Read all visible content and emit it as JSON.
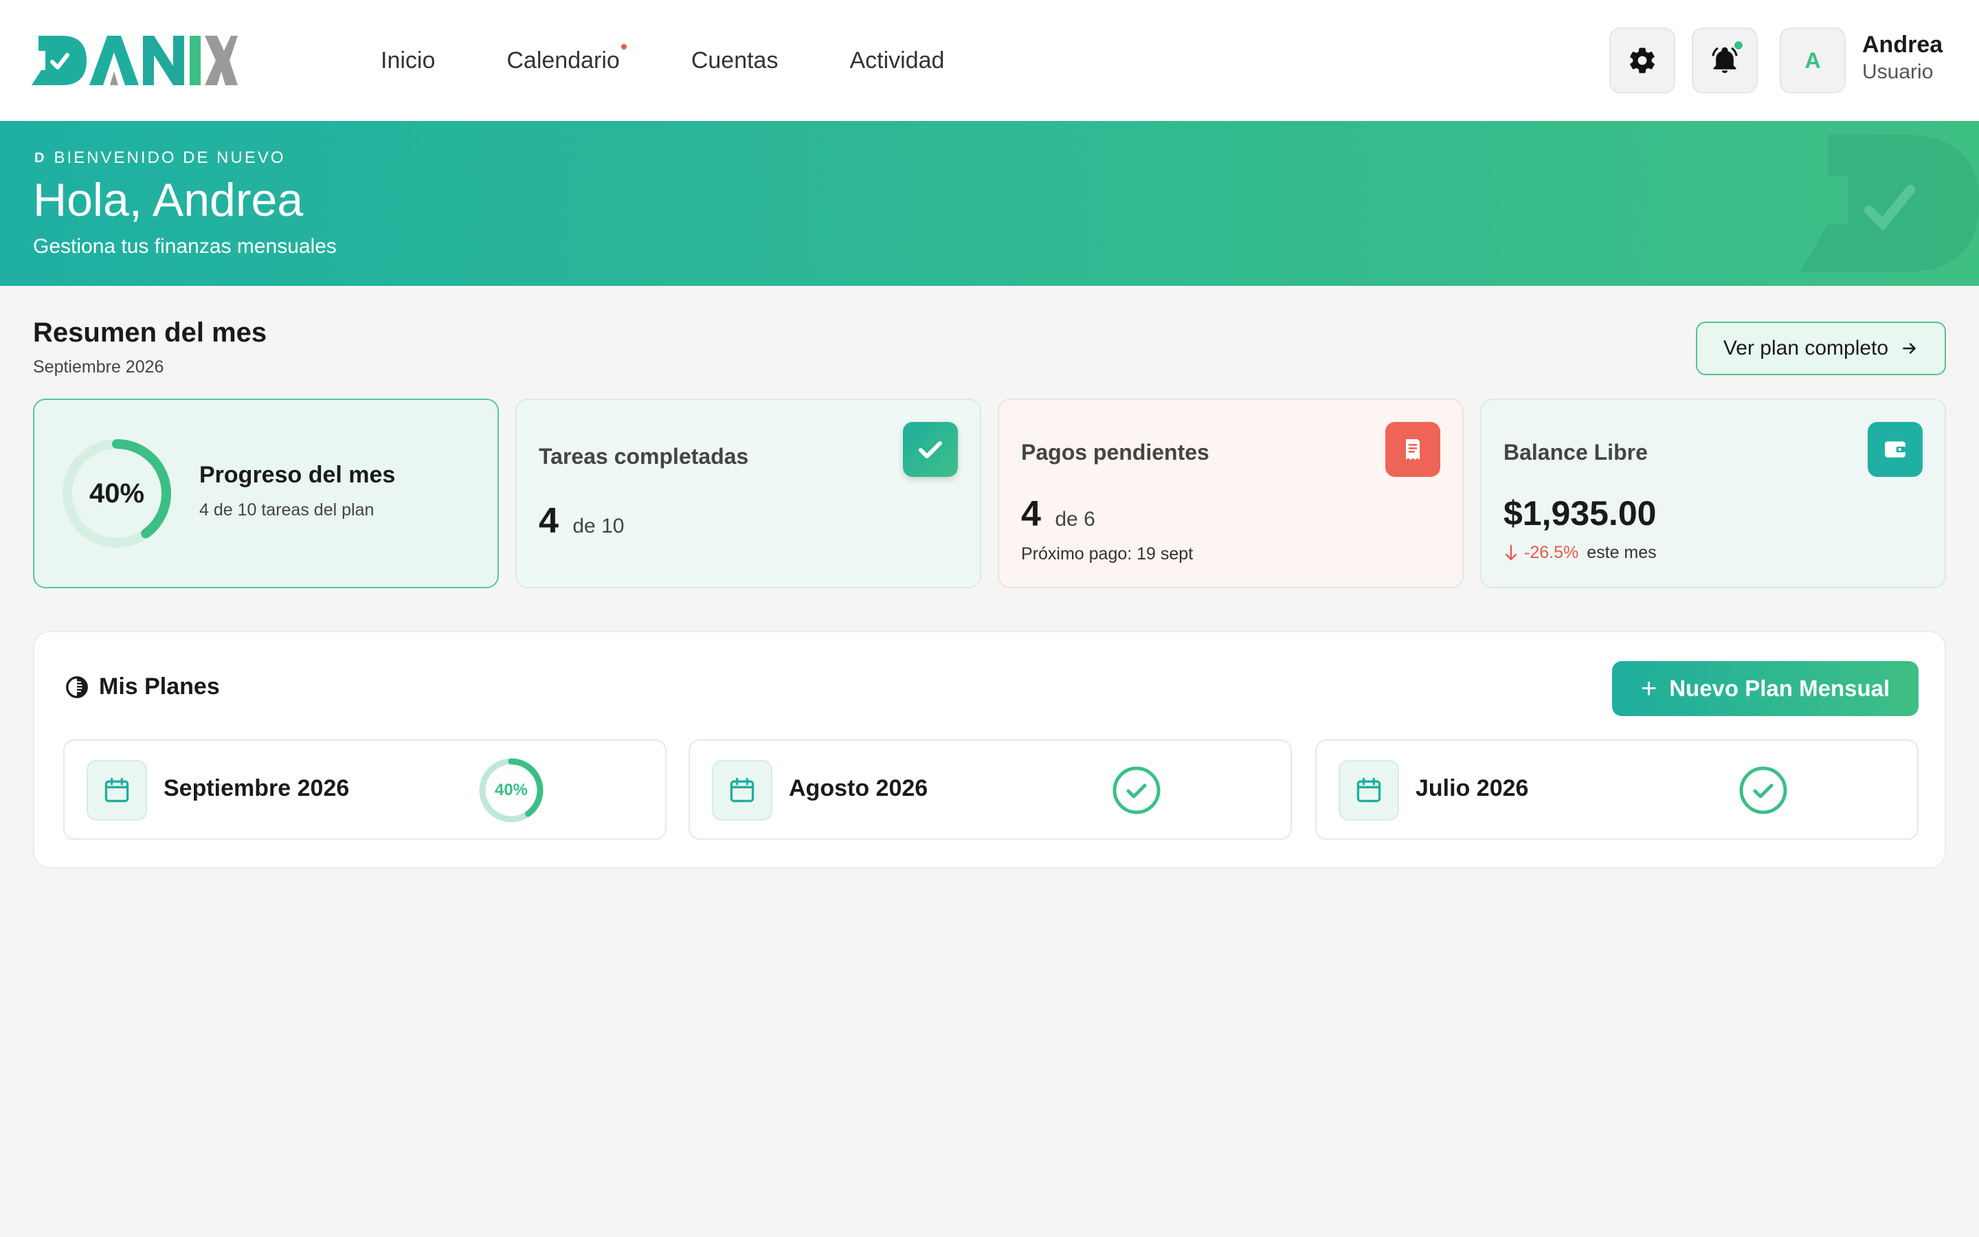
{
  "app": {
    "logo": "DANIX"
  },
  "nav": {
    "items": [
      {
        "label": "Inicio"
      },
      {
        "label": "Calendario",
        "has_badge": true
      },
      {
        "label": "Cuentas"
      },
      {
        "label": "Actividad"
      }
    ]
  },
  "header": {
    "icons": [
      "gear-icon",
      "bell-icon"
    ],
    "notification_dot_color": "#3bbf86",
    "avatar_initial": "A",
    "user_name": "Andrea",
    "user_role": "Usuario"
  },
  "banner": {
    "eyebrow_logo": "D",
    "eyebrow": "BIENVENIDO DE NUEVO",
    "title": "Hola, Andrea",
    "subtitle": "Gestiona tus finanzas mensuales"
  },
  "summary": {
    "title": "Resumen del mes",
    "subtitle": "Septiembre 2026",
    "plan_button": "Ver plan completo",
    "progress": {
      "percent": 40,
      "label": "40%",
      "title": "Progreso del mes",
      "subtitle": "4 de 10 tareas del plan"
    },
    "tasks": {
      "title": "Tareas completadas",
      "value": "4",
      "of": "de 10",
      "icon": "check-icon"
    },
    "payments": {
      "title": "Pagos pendientes",
      "value": "4",
      "of": "de 6",
      "next": "Próximo pago: 19 sept",
      "icon": "receipt-icon"
    },
    "balance": {
      "title": "Balance Libre",
      "value": "$1,935.00",
      "delta": "-26.5%",
      "delta_suffix": "este mes",
      "icon": "wallet-icon"
    }
  },
  "plans": {
    "title": "Mis Planes",
    "new_button": "Nuevo Plan Mensual",
    "items": [
      {
        "name": "Septiembre 2026",
        "status": "progress",
        "percent": 40,
        "label": "40%"
      },
      {
        "name": "Agosto 2026",
        "status": "complete"
      },
      {
        "name": "Julio 2026",
        "status": "complete"
      }
    ]
  },
  "colors": {
    "brand": "#1fae9e",
    "accent": "#3ebf84",
    "danger": "#e85a4f",
    "muted": "#9a9a9a"
  }
}
